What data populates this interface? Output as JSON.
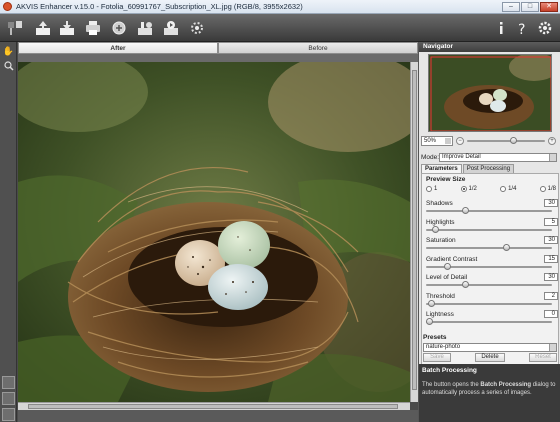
{
  "window": {
    "title": "AKVIS Enhancer v.15.0 - Fotolia_60991767_Subscription_XL.jpg (RGB/8, 3955x2632)",
    "min": "–",
    "max": "□",
    "close": "✕"
  },
  "view_tabs": [
    "After",
    "Before"
  ],
  "navigator": {
    "title": "Navigator",
    "zoom": "50%",
    "zoom_level": 0.6
  },
  "mode": {
    "label": "Mode:",
    "value": "Improve Detail"
  },
  "param_tabs": [
    "Parameters",
    "Post Processing"
  ],
  "preview_size": {
    "title": "Preview Size",
    "options": [
      "1",
      "1/2",
      "1/4",
      "1/8"
    ],
    "selected": "1/2"
  },
  "params": [
    {
      "label": "Shadows",
      "value": "30",
      "level": 0.3
    },
    {
      "label": "Highlights",
      "value": "5",
      "level": 0.05
    },
    {
      "label": "Saturation",
      "value": "30",
      "level": 0.65
    },
    {
      "label": "Gradient Contrast",
      "value": "15",
      "level": 0.15
    },
    {
      "label": "Level of Detail",
      "value": "30",
      "level": 0.3
    },
    {
      "label": "Threshold",
      "value": "2",
      "level": 0.02
    },
    {
      "label": "Lightness",
      "value": "0",
      "level": 0.0
    }
  ],
  "presets": {
    "title": "Presets",
    "value": "nature-photo",
    "save": "Save",
    "delete": "Delete",
    "reset": "Reset"
  },
  "batch": {
    "title": "Batch Processing",
    "desc_pre": "The button opens the ",
    "desc_bold": "Batch Processing",
    "desc_post": " dialog to automatically process a series of images."
  },
  "toolbar_icons": [
    "open-icon",
    "save-icon",
    "import-icon",
    "print-icon",
    "share-icon",
    "batch-icon",
    "run-icon",
    "apply-icon",
    "info-icon",
    "help-icon",
    "settings-icon"
  ],
  "colors": {
    "accent": "#3a3a3a",
    "panel": "#e6e6e6"
  }
}
